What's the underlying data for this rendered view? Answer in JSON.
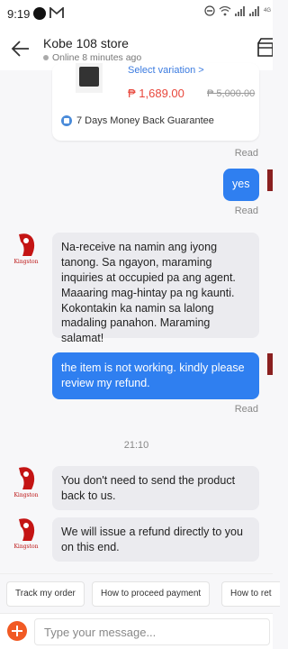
{
  "status": {
    "time": "9:19",
    "battery_label": "4G"
  },
  "header": {
    "store_name": "Kobe 108 store",
    "online_status": "Online 8 minutes ago"
  },
  "product": {
    "variation_label": "Select variation >",
    "price": "₱ 1,689.00",
    "old_price": "₱ 5,000.00",
    "guarantee": "7 Days Money Back Guarantee"
  },
  "messages": {
    "read_1": "Read",
    "out_1": "yes",
    "read_2": "Read",
    "in_1": "Na-receive na namin ang iyong tanong. Sa ngayon, maraming inquiries at occupied pa ang agent. Maaaring mag-hintay pa ng kaunti. Kokontakin ka namin sa lalong madaling panahon. Maraming salamat!",
    "out_2": "the item is not working. kindly please review my refund.",
    "read_3": "Read",
    "time_sep": "21:10",
    "in_2": "You don't need to send the product back to us.",
    "in_3": "We will issue a refund directly to you on this end."
  },
  "avatar_label": "Kingston",
  "quick_replies": [
    "Track my order",
    "How to proceed payment",
    "How to ret"
  ],
  "input": {
    "placeholder": "Type your message..."
  },
  "colors": {
    "accent_blue": "#2f7ff0",
    "price_red": "#e8473c",
    "plus_orange": "#f15a24"
  }
}
